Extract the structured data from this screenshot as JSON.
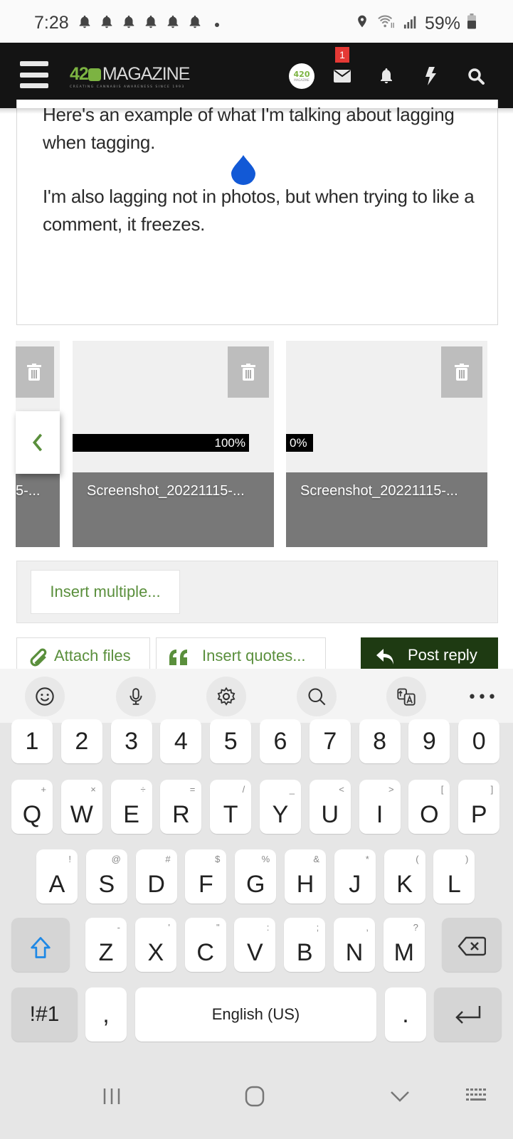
{
  "status_bar": {
    "time": "7:28",
    "notification_icons": [
      "bell-icon",
      "bell-icon",
      "bell-icon",
      "bell-icon",
      "bell-icon",
      "bell-icon"
    ],
    "battery": "59%"
  },
  "header": {
    "logo_number": "42",
    "logo_text": "MAGAZINE",
    "logo_tagline": "CREATING CANNABIS AWARENESS SINCE 1993",
    "avatar_top": "420",
    "avatar_bottom": "MAGAZINE",
    "messages_badge": "1",
    "accent_color": "#7cb342"
  },
  "editor": {
    "paragraphs": [
      "Here's an example of what I'm talking about lagging when tagging.",
      "I'm also lagging not in photos, but when trying to like a comment, it freezes."
    ]
  },
  "attachments": [
    {
      "caption": "5-...",
      "progress": null
    },
    {
      "caption": "Screenshot_20221115-...",
      "progress": 100,
      "progress_label": "100%"
    },
    {
      "caption": "Screenshot_20221115-...",
      "progress": 0,
      "progress_label": "0%"
    }
  ],
  "actions": {
    "insert_multiple": "Insert multiple...",
    "attach_files": "Attach files",
    "insert_quotes": "Insert quotes...",
    "post_reply": "Post reply",
    "post_reply_color": "#1e3a12",
    "link_color": "#5a8f3c"
  },
  "keyboard": {
    "toolbar": [
      "emoji-icon",
      "microphone-icon",
      "settings-icon",
      "search-icon",
      "translate-icon",
      "more-icon"
    ],
    "numbers": [
      "1",
      "2",
      "3",
      "4",
      "5",
      "6",
      "7",
      "8",
      "9",
      "0"
    ],
    "row1": [
      {
        "k": "Q",
        "s": "+"
      },
      {
        "k": "W",
        "s": "×"
      },
      {
        "k": "E",
        "s": "÷"
      },
      {
        "k": "R",
        "s": "="
      },
      {
        "k": "T",
        "s": "/"
      },
      {
        "k": "Y",
        "s": "_"
      },
      {
        "k": "U",
        "s": "<"
      },
      {
        "k": "I",
        "s": ">"
      },
      {
        "k": "O",
        "s": "["
      },
      {
        "k": "P",
        "s": "]"
      }
    ],
    "row2": [
      {
        "k": "A",
        "s": "!"
      },
      {
        "k": "S",
        "s": "@"
      },
      {
        "k": "D",
        "s": "#"
      },
      {
        "k": "F",
        "s": "$"
      },
      {
        "k": "G",
        "s": "%"
      },
      {
        "k": "H",
        "s": "&"
      },
      {
        "k": "J",
        "s": "*"
      },
      {
        "k": "K",
        "s": "("
      },
      {
        "k": "L",
        "s": ")"
      }
    ],
    "row3": [
      {
        "k": "Z",
        "s": "-"
      },
      {
        "k": "X",
        "s": "'"
      },
      {
        "k": "C",
        "s": "\""
      },
      {
        "k": "V",
        "s": ":"
      },
      {
        "k": "B",
        "s": ";"
      },
      {
        "k": "N",
        "s": ","
      },
      {
        "k": "M",
        "s": "?"
      }
    ],
    "symbols_key": "!#1",
    "comma_key": ",",
    "space_label": "English (US)",
    "period_key": "."
  }
}
